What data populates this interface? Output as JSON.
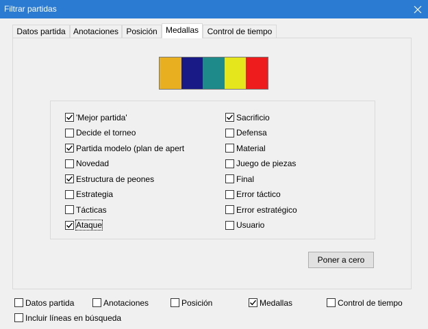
{
  "window": {
    "title": "Filtrar partidas"
  },
  "tabs": [
    {
      "label": "Datos partida",
      "active": false
    },
    {
      "label": "Anotaciones",
      "active": false
    },
    {
      "label": "Posición",
      "active": false
    },
    {
      "label": "Medallas",
      "active": true
    },
    {
      "label": "Control de tiempo",
      "active": false
    }
  ],
  "medal_colors": [
    "#e8b020",
    "#1a1a86",
    "#1e8a8a",
    "#e6e61c",
    "#ee1c1c"
  ],
  "medallas": {
    "left": [
      {
        "label": "'Mejor partida'",
        "checked": true
      },
      {
        "label": "Decide el torneo",
        "checked": false
      },
      {
        "label": "Partida modelo (plan de apert",
        "checked": true
      },
      {
        "label": "Novedad",
        "checked": false
      },
      {
        "label": "Estructura de peones",
        "checked": true
      },
      {
        "label": "Estrategia",
        "checked": false
      },
      {
        "label": "Tácticas",
        "checked": false
      },
      {
        "label": "Ataque",
        "checked": true
      }
    ],
    "right": [
      {
        "label": "Sacrificio",
        "checked": true
      },
      {
        "label": "Defensa",
        "checked": false
      },
      {
        "label": "Material",
        "checked": false
      },
      {
        "label": "Juego de piezas",
        "checked": false
      },
      {
        "label": "Final",
        "checked": false
      },
      {
        "label": "Error táctico",
        "checked": false
      },
      {
        "label": "Error estratégico",
        "checked": false
      },
      {
        "label": "Usuario",
        "checked": false
      }
    ],
    "reset_label": "Poner a cero"
  },
  "bottom": {
    "datos_partida": {
      "label": "Datos partida",
      "checked": false
    },
    "anotaciones": {
      "label": "Anotaciones",
      "checked": false
    },
    "posicion": {
      "label": "Posición",
      "checked": false
    },
    "medallas": {
      "label": "Medallas",
      "checked": true
    },
    "control": {
      "label": "Control de tiempo",
      "checked": false
    },
    "incluir": {
      "label": "Incluir líneas en búsqueda",
      "checked": false
    }
  }
}
